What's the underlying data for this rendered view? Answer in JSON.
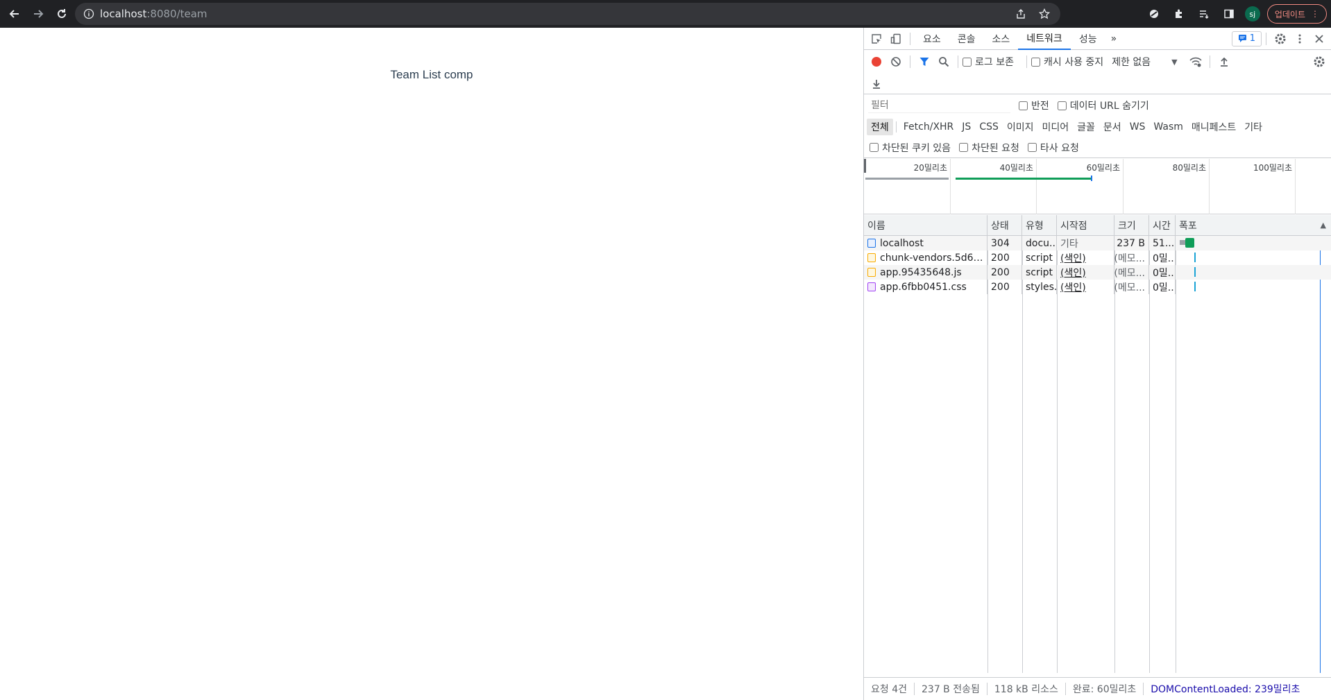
{
  "browser": {
    "url_host": "localhost",
    "url_path": ":8080/team",
    "avatar_initials": "sj",
    "update_label": "업데이트"
  },
  "page": {
    "heading": "Team List comp"
  },
  "devtools": {
    "tabs": [
      {
        "label": "요소",
        "active": false
      },
      {
        "label": "콘솔",
        "active": false
      },
      {
        "label": "소스",
        "active": false
      },
      {
        "label": "네트워크",
        "active": true
      },
      {
        "label": "성능",
        "active": false
      }
    ],
    "more_tabs": "»",
    "issues_count": "1",
    "toolbar": {
      "preserve_log": "로그 보존",
      "disable_cache": "캐시 사용 중지",
      "throttle": "제한 없음"
    },
    "filter": {
      "placeholder": "필터",
      "invert": "반전",
      "hide_data_urls": "데이터 URL 숨기기"
    },
    "types": [
      "전체",
      "Fetch/XHR",
      "JS",
      "CSS",
      "이미지",
      "미디어",
      "글꼴",
      "문서",
      "WS",
      "Wasm",
      "매니페스트",
      "기타"
    ],
    "blocked": {
      "blocked_cookies": "차단된 쿠키 있음",
      "blocked_requests": "차단된 요청",
      "third_party": "타사 요청"
    },
    "overview_ticks": [
      "20밀리초",
      "40밀리초",
      "60밀리초",
      "80밀리초",
      "100밀리초"
    ],
    "columns": {
      "name": "이름",
      "status": "상태",
      "type": "유형",
      "initiator": "시작점",
      "size": "크기",
      "time": "시간",
      "waterfall": "폭포"
    },
    "requests": [
      {
        "name": "localhost",
        "status": "304",
        "type": "docu...",
        "initiator": "기타",
        "initiator_link": false,
        "size": "237 B",
        "time": "51...",
        "kind": "doc"
      },
      {
        "name": "chunk-vendors.5d66e1d9...",
        "status": "200",
        "type": "script",
        "initiator": "(색인)",
        "initiator_link": true,
        "size": "(메모...",
        "time": "0밀...",
        "kind": "js"
      },
      {
        "name": "app.95435648.js",
        "status": "200",
        "type": "script",
        "initiator": "(색인)",
        "initiator_link": true,
        "size": "(메모...",
        "time": "0밀...",
        "kind": "js"
      },
      {
        "name": "app.6fbb0451.css",
        "status": "200",
        "type": "styles...",
        "initiator": "(색인)",
        "initiator_link": true,
        "size": "(메모...",
        "time": "0밀...",
        "kind": "css"
      }
    ],
    "status_bar": {
      "requests": "요청 4건",
      "transferred": "237 B 전송됨",
      "resources": "118 kB 리소스",
      "finish": "완료: 60밀리초",
      "dom_content_loaded": "DOMContentLoaded: 239밀리초"
    },
    "colors": {
      "accent": "#1a73e8",
      "record": "#ea4335",
      "waterfall_green": "#0f9d58",
      "waterfall_blue": "#1aa3d6"
    }
  }
}
